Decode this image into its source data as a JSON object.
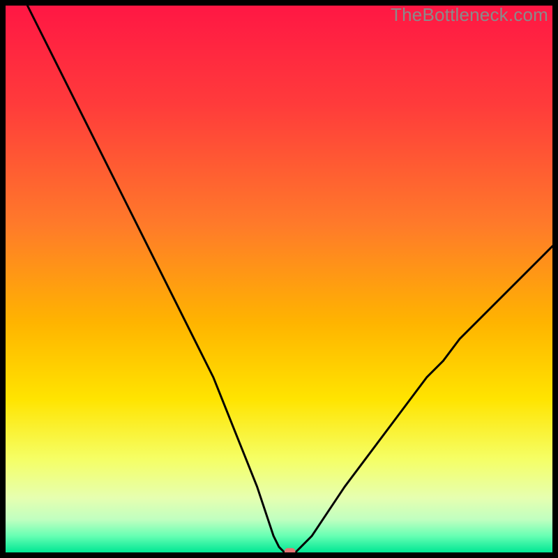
{
  "watermark": "TheBottleneck.com",
  "chart_data": {
    "type": "line",
    "title": "",
    "xlabel": "",
    "ylabel": "",
    "xlim": [
      0,
      100
    ],
    "ylim": [
      0,
      100
    ],
    "grid": false,
    "legend": false,
    "background": {
      "type": "vertical-gradient",
      "stops": [
        {
          "pos": 0.0,
          "color": "#ff1744"
        },
        {
          "pos": 0.18,
          "color": "#ff3b3b"
        },
        {
          "pos": 0.4,
          "color": "#ff7a2a"
        },
        {
          "pos": 0.58,
          "color": "#ffb400"
        },
        {
          "pos": 0.72,
          "color": "#ffe400"
        },
        {
          "pos": 0.83,
          "color": "#f5ff66"
        },
        {
          "pos": 0.9,
          "color": "#e6ffb0"
        },
        {
          "pos": 0.94,
          "color": "#c0ffc0"
        },
        {
          "pos": 0.97,
          "color": "#66ffb3"
        },
        {
          "pos": 1.0,
          "color": "#00e694"
        }
      ]
    },
    "series": [
      {
        "name": "bottleneck-curve",
        "stroke": "#000000",
        "stroke_width": 3,
        "x": [
          4,
          6,
          8,
          10,
          12,
          14,
          16,
          18,
          20,
          22,
          24,
          26,
          28,
          30,
          32,
          34,
          36,
          38,
          40,
          42,
          44,
          46,
          48,
          49,
          50,
          51,
          52,
          53,
          54,
          56,
          58,
          60,
          62,
          65,
          68,
          71,
          74,
          77,
          80,
          83,
          86,
          89,
          92,
          95,
          98,
          100
        ],
        "y": [
          100,
          96,
          92,
          88,
          84,
          80,
          76,
          72,
          68,
          64,
          60,
          56,
          52,
          48,
          44,
          40,
          36,
          32,
          27,
          22,
          17,
          12,
          6,
          3,
          1,
          0,
          0,
          0,
          1,
          3,
          6,
          9,
          12,
          16,
          20,
          24,
          28,
          32,
          35,
          39,
          42,
          45,
          48,
          51,
          54,
          56
        ]
      }
    ],
    "marker": {
      "name": "optimal-point",
      "x": 52,
      "y": 0.2,
      "shape": "rounded-rect",
      "fill": "#e57373",
      "width_units": 2.0,
      "height_units": 1.2
    },
    "plot_border": {
      "color": "#000000",
      "width": 8
    }
  }
}
